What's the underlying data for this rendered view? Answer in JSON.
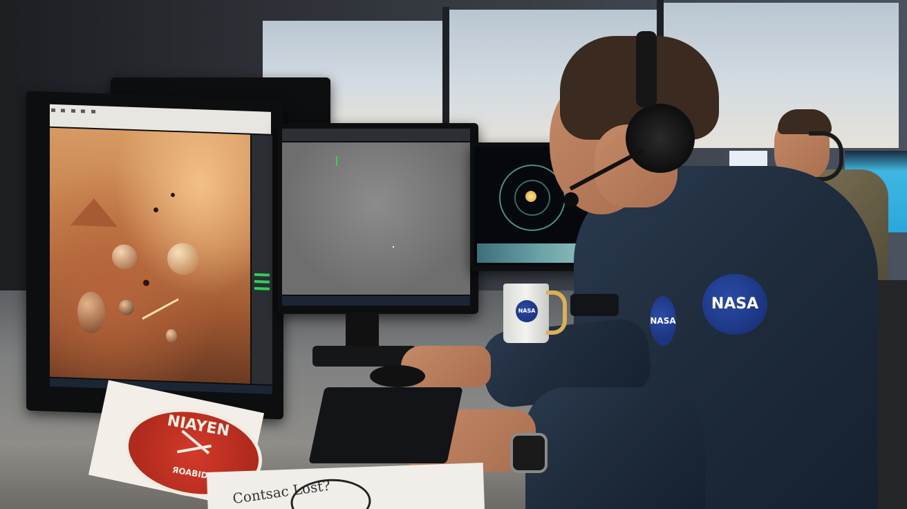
{
  "scene": {
    "description_colors": {
      "mars_accent": "#c07a48",
      "nasa_blue": "#1c3580",
      "orbit_green": "#4f8f7d",
      "sticker_red": "#b02a1d"
    }
  },
  "patches": {
    "chest_logo": "NASA",
    "sleeve_logo": "NASA",
    "mug_logo": "NASA"
  },
  "sticker": {
    "top_text": "NIAYEN",
    "bottom_text": "ЯOAВID"
  },
  "notebook": {
    "handwriting": "Contsac Lost?"
  },
  "icons": [
    "monitor-icon",
    "headset-icon",
    "mouse-icon",
    "keyboard-icon",
    "watch-icon",
    "mug-icon"
  ]
}
